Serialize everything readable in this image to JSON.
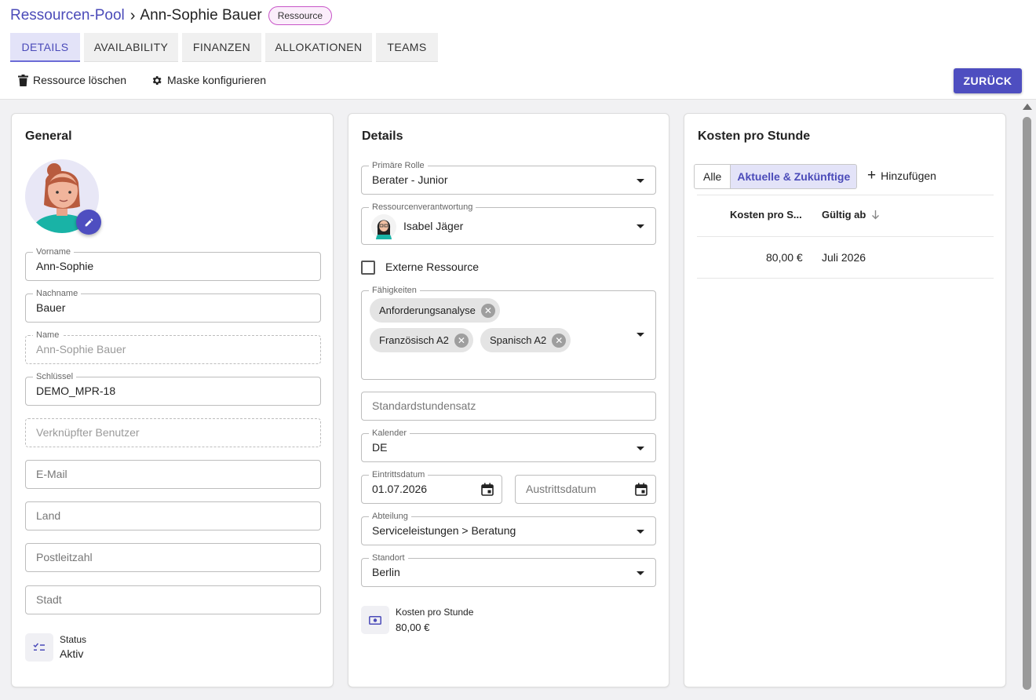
{
  "breadcrumb": {
    "parent": "Ressourcen-Pool",
    "separator": "›",
    "current": "Ann-Sophie Bauer",
    "badge": "Ressource"
  },
  "tabs": [
    "DETAILS",
    "AVAILABILITY",
    "FINANZEN",
    "ALLOKATIONEN",
    "TEAMS"
  ],
  "toolbar": {
    "delete_label": "Ressource löschen",
    "configure_label": "Maske konfigurieren",
    "back_label": "ZURÜCK"
  },
  "general": {
    "title": "General",
    "vorname": {
      "label": "Vorname",
      "value": "Ann-Sophie"
    },
    "nachname": {
      "label": "Nachname",
      "value": "Bauer"
    },
    "name": {
      "label": "Name",
      "value": "Ann-Sophie Bauer"
    },
    "schluessel": {
      "label": "Schlüssel",
      "value": "DEMO_MPR-18"
    },
    "benutzer_placeholder": "Verknüpfter Benutzer",
    "email_placeholder": "E-Mail",
    "land_placeholder": "Land",
    "plz_placeholder": "Postleitzahl",
    "stadt_placeholder": "Stadt",
    "status": {
      "label": "Status",
      "value": "Aktiv"
    }
  },
  "details": {
    "title": "Details",
    "rolle": {
      "label": "Primäre Rolle",
      "value": "Berater - Junior"
    },
    "verantwortung": {
      "label": "Ressourcenverantwortung",
      "value": "Isabel Jäger"
    },
    "extern_label": "Externe Ressource",
    "extern_checked": false,
    "faehigkeiten": {
      "label": "Fähigkeiten",
      "chips": [
        "Anforderungsanalyse",
        "Französisch A2",
        "Spanisch A2"
      ]
    },
    "stundensatz_placeholder": "Standardstundensatz",
    "kalender": {
      "label": "Kalender",
      "value": "DE"
    },
    "eintritt": {
      "label": "Eintrittsdatum",
      "value": "01.07.2026"
    },
    "austritt_placeholder": "Austrittsdatum",
    "abteilung": {
      "label": "Abteilung",
      "value": "Serviceleistungen > Beratung"
    },
    "standort": {
      "label": "Standort",
      "value": "Berlin"
    },
    "kosten": {
      "label": "Kosten pro Stunde",
      "value": "80,00 €"
    }
  },
  "costs": {
    "title": "Kosten pro Stunde",
    "filter_all": "Alle",
    "filter_current": "Aktuelle & Zukünftige",
    "add_label": "Hinzufügen",
    "headers": [
      "Kosten pro S...",
      "Gültig ab"
    ],
    "rows": [
      {
        "kosten": "80,00 €",
        "gueltig": "Juli 2026"
      }
    ]
  },
  "colors": {
    "accent": "#4e4ec0",
    "badge_border": "#c855c8"
  }
}
